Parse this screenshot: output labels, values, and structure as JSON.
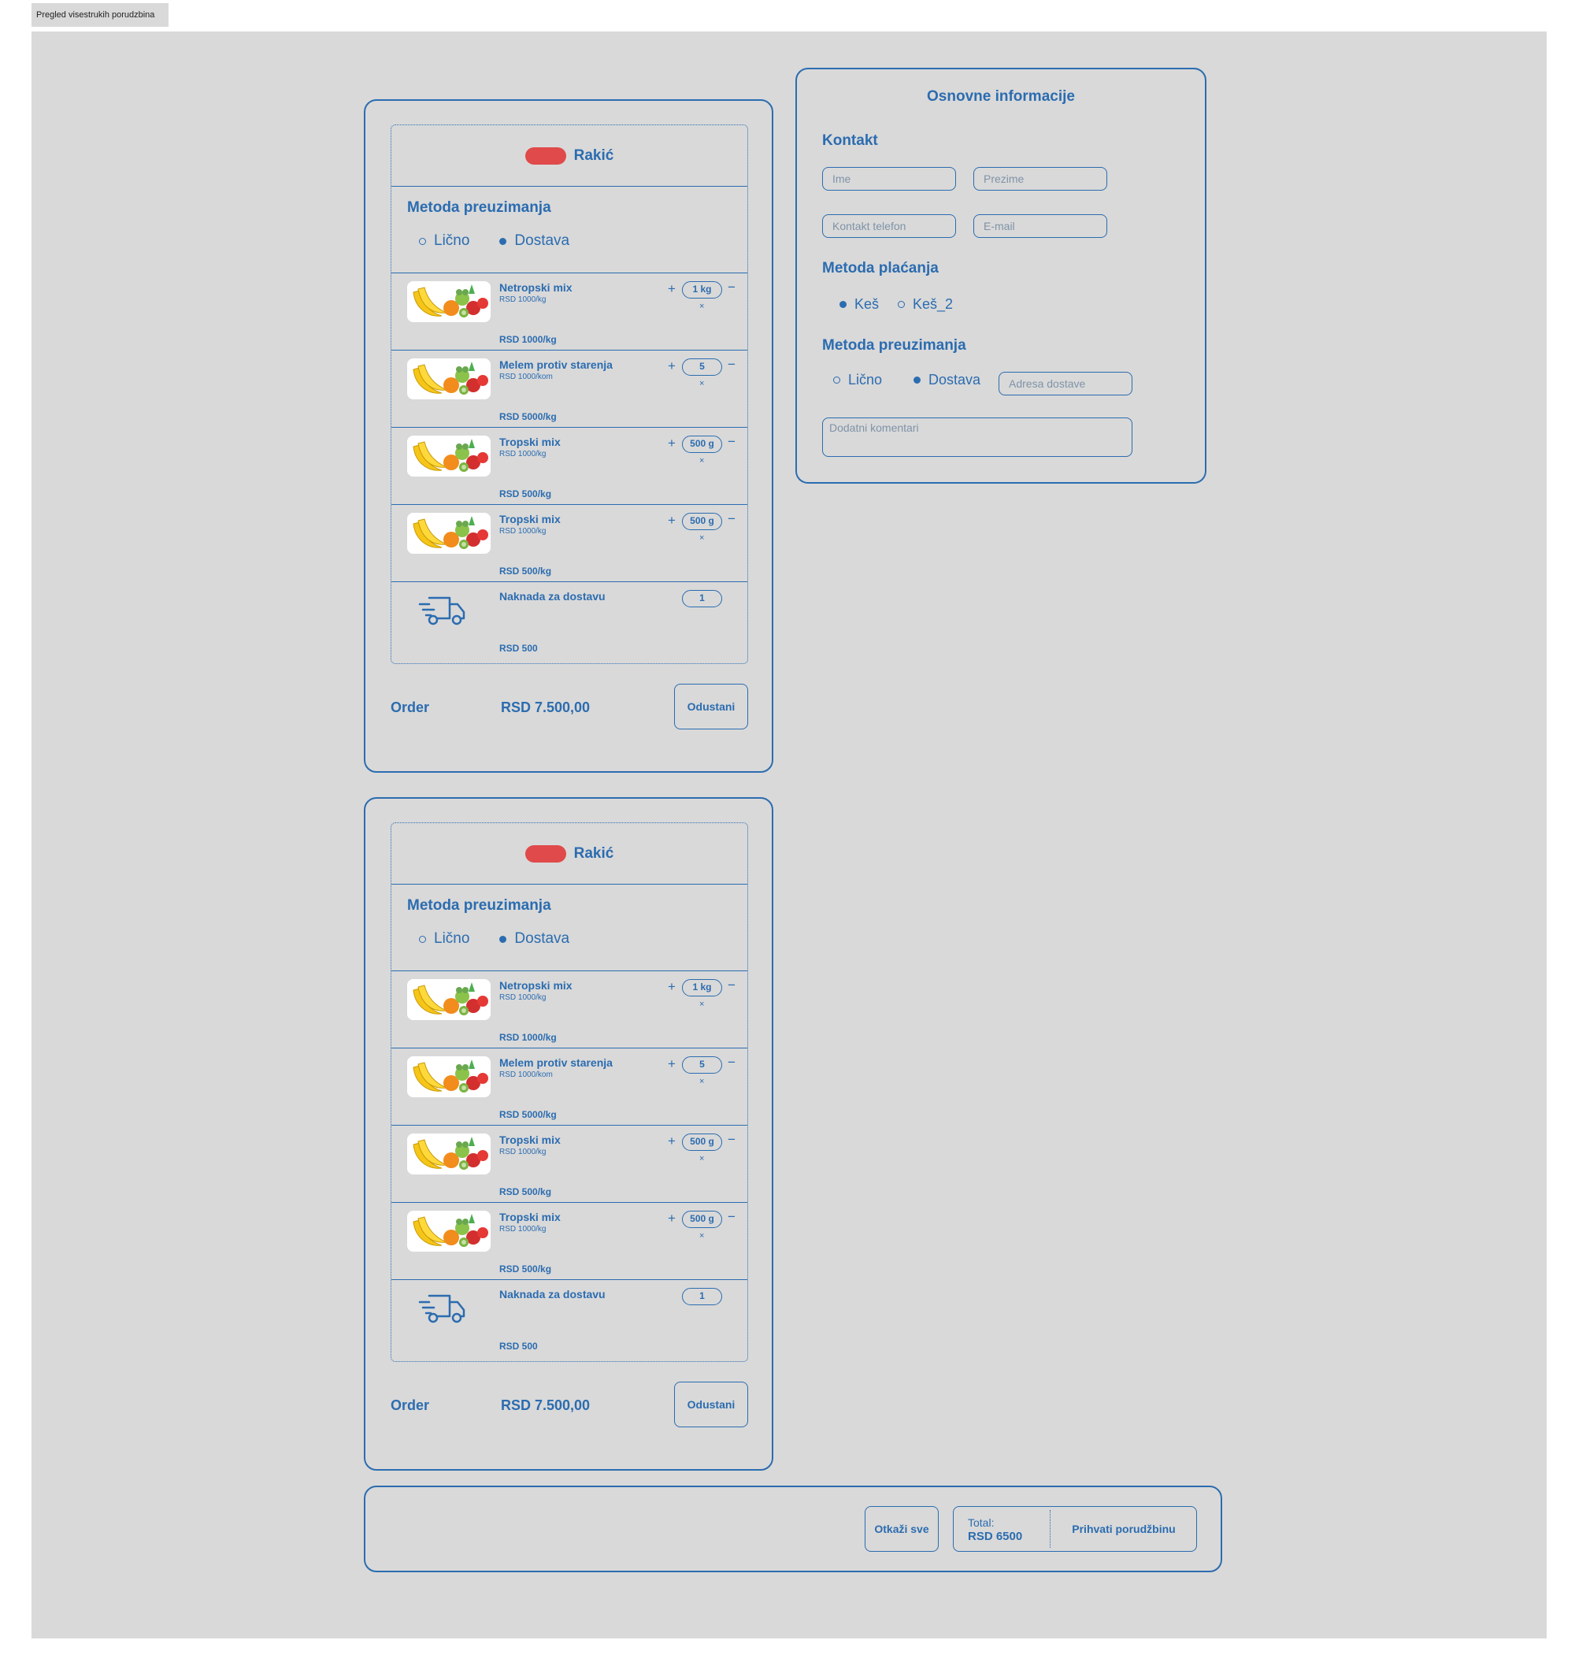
{
  "page_tab": "Pregled visestrukih porudzbina",
  "orders": [
    {
      "shop": "Rakić",
      "pickup_title": "Metoda preuzimanja",
      "pickup_options": [
        "Lično",
        "Dostava"
      ],
      "pickup_selected": "Dostava",
      "items": [
        {
          "name": "Netropski mix",
          "unit_price": "RSD 1000/kg",
          "qty": "1 kg",
          "total": "RSD 1000/kg",
          "icon": "fruit-image"
        },
        {
          "name": "Melem protiv starenja",
          "unit_price": "RSD 1000/kom",
          "qty": "5",
          "total": "RSD 5000/kg",
          "icon": "fruit-image"
        },
        {
          "name": "Tropski mix",
          "unit_price": "RSD 1000/kg",
          "qty": "500 g",
          "total": "RSD 500/kg",
          "icon": "fruit-image"
        },
        {
          "name": "Tropski mix",
          "unit_price": "RSD 1000/kg",
          "qty": "500 g",
          "total": "RSD 500/kg",
          "icon": "fruit-image"
        },
        {
          "name": "Naknada za dostavu",
          "unit_price": "",
          "qty": "1",
          "total": "RSD 500",
          "icon": "delivery-truck-icon"
        }
      ],
      "order_label": "Order",
      "order_total": "RSD 7.500,00",
      "cancel_label": "Odustani"
    },
    {
      "shop": "Rakić",
      "pickup_title": "Metoda preuzimanja",
      "pickup_options": [
        "Lično",
        "Dostava"
      ],
      "pickup_selected": "Dostava",
      "items": [
        {
          "name": "Netropski mix",
          "unit_price": "RSD 1000/kg",
          "qty": "1 kg",
          "total": "RSD 1000/kg",
          "icon": "fruit-image"
        },
        {
          "name": "Melem protiv starenja",
          "unit_price": "RSD 1000/kom",
          "qty": "5",
          "total": "RSD 5000/kg",
          "icon": "fruit-image"
        },
        {
          "name": "Tropski mix",
          "unit_price": "RSD 1000/kg",
          "qty": "500 g",
          "total": "RSD 500/kg",
          "icon": "fruit-image"
        },
        {
          "name": "Tropski mix",
          "unit_price": "RSD 1000/kg",
          "qty": "500 g",
          "total": "RSD 500/kg",
          "icon": "fruit-image"
        },
        {
          "name": "Naknada za dostavu",
          "unit_price": "",
          "qty": "1",
          "total": "RSD 500",
          "icon": "delivery-truck-icon"
        }
      ],
      "order_label": "Order",
      "order_total": "RSD 7.500,00",
      "cancel_label": "Odustani"
    }
  ],
  "qty_controls": {
    "plus": "+",
    "minus": "−",
    "remove": "×"
  },
  "info": {
    "title": "Osnovne informacije",
    "contact_title": "Kontakt",
    "first_name_placeholder": "Ime",
    "last_name_placeholder": "Prezime",
    "phone_placeholder": "Kontakt telefon",
    "email_placeholder": "E-mail",
    "payment_title": "Metoda plaćanja",
    "payment_options": [
      "Keš",
      "Keš_2"
    ],
    "payment_selected": "Keš",
    "pickup_title": "Metoda preuzimanja",
    "pickup_options": [
      "Lično",
      "Dostava"
    ],
    "pickup_selected": "Dostava",
    "address_placeholder": "Adresa dostave",
    "comment_placeholder": "Dodatni komentari"
  },
  "footer": {
    "cancel_all_label": "Otkaži sve",
    "total_label": "Total:",
    "total_value": "RSD 6500",
    "accept_label": "Prihvati porudžbinu"
  },
  "colors": {
    "accent": "#2b6cb0",
    "shop_pill": "#e04a4a",
    "background": "#d9d9d9"
  }
}
